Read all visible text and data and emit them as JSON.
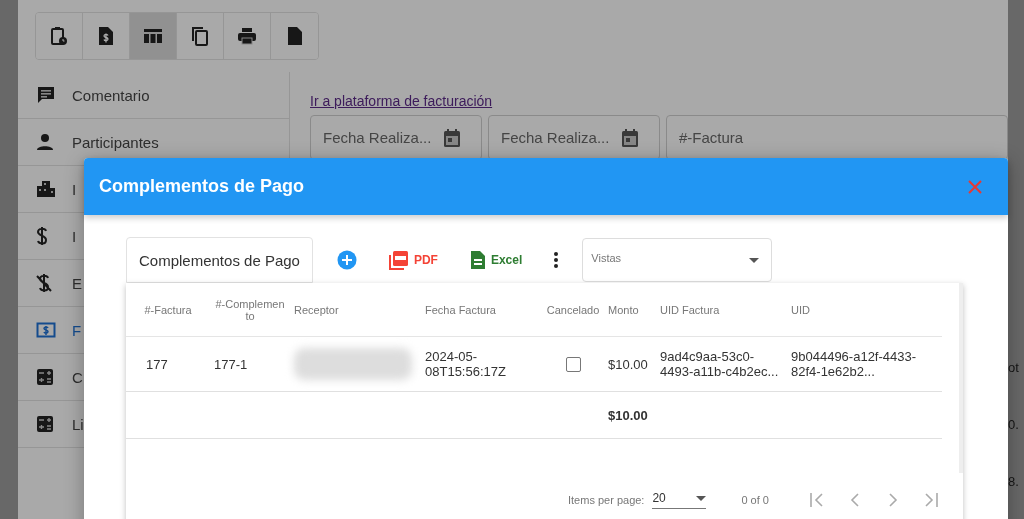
{
  "toolbar": [
    {
      "kind": "clipboard-clock",
      "selected": false
    },
    {
      "kind": "invoice",
      "selected": false
    },
    {
      "kind": "table",
      "selected": true
    },
    {
      "kind": "copy",
      "selected": false
    },
    {
      "kind": "print",
      "selected": false
    },
    {
      "kind": "file",
      "selected": false
    }
  ],
  "sidebar": {
    "items": [
      {
        "kind": "comment",
        "label": "Comentario",
        "selected": false
      },
      {
        "kind": "person",
        "label": "Participantes",
        "selected": false
      },
      {
        "kind": "building",
        "label": "I",
        "selected": false
      },
      {
        "kind": "dollar",
        "label": "I",
        "selected": false
      },
      {
        "kind": "money-off",
        "label": "E",
        "selected": false
      },
      {
        "kind": "money-box",
        "label": "F",
        "selected": true
      },
      {
        "kind": "calculator",
        "label": "C",
        "selected": false
      },
      {
        "kind": "calculator",
        "label": "Li",
        "selected": false
      }
    ]
  },
  "link": "Ir a plataforma de facturación",
  "filters": [
    {
      "kind": "date",
      "placeholder": "Fecha Realiza..."
    },
    {
      "kind": "date",
      "placeholder": "Fecha Realiza..."
    },
    {
      "kind": "text",
      "placeholder": "#-Factura"
    }
  ],
  "right_edge_fragments": [
    "ot",
    "0.",
    "8."
  ],
  "dialog": {
    "title": "Complementos de Pago",
    "toolbar": {
      "title": "Complementos de Pago",
      "buttons": [
        {
          "kind": "add"
        },
        {
          "kind": "pdf",
          "label": "PDF"
        },
        {
          "kind": "excel",
          "label": "Excel"
        },
        {
          "kind": "more"
        }
      ],
      "views": {
        "placeholder": "Vistas"
      }
    },
    "table": {
      "columns": [
        {
          "label": "#-Factura",
          "kind": "text"
        },
        {
          "label": "#-Complemento",
          "kind": "text"
        },
        {
          "label": "Receptor",
          "kind": "redacted"
        },
        {
          "label": "Fecha Factura",
          "kind": "text"
        },
        {
          "label": "Cancelado",
          "kind": "checkbox"
        },
        {
          "label": "Monto",
          "kind": "amount"
        },
        {
          "label": "UID Factura",
          "kind": "text"
        },
        {
          "label": "UID",
          "kind": "text"
        }
      ],
      "rows": [
        {
          "cells": [
            "177",
            "177-1",
            null,
            "2024-05-08T15:56:17Z",
            null,
            "$10.00",
            "9ad4c9aa-53c0-4493-a11b-c4b2ec...",
            "9b044496-a12f-4433-82f4-1e62b2..."
          ],
          "cancelado": false
        }
      ],
      "total": "$10.00"
    },
    "paginator": {
      "label": "Items per page:",
      "page_size": "20",
      "range": "0 of 0"
    }
  }
}
